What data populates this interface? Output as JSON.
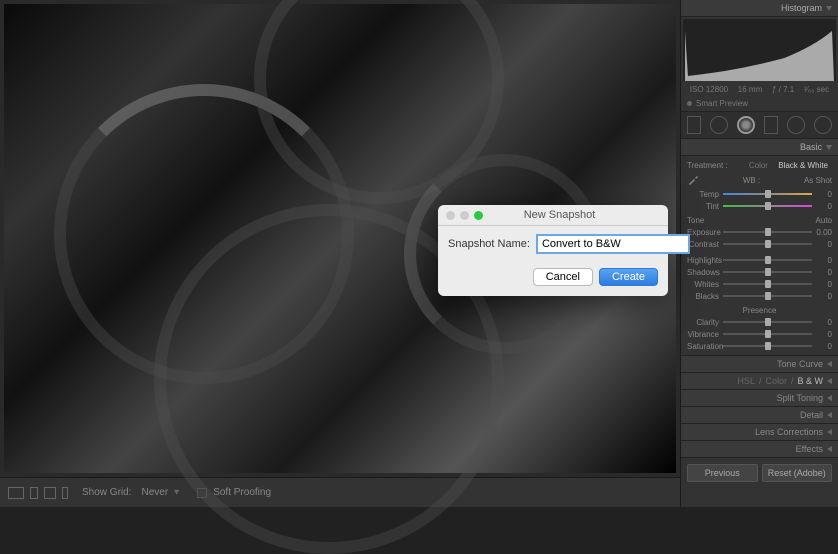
{
  "sidebar": {
    "histogram_label": "Histogram",
    "metadata": {
      "iso": "ISO 12800",
      "focal": "16 mm",
      "aperture": "ƒ / 7.1",
      "shutter": "¹⁄₆₀ sec"
    },
    "smart_preview": "Smart Preview",
    "basic": {
      "label": "Basic",
      "treatment": "Treatment :",
      "color": "Color",
      "bw": "Black & White",
      "wb_label": "WB :",
      "wb_value": "As Shot",
      "temp_label": "Temp",
      "temp_val": "0",
      "tint_label": "Tint",
      "tint_val": "0",
      "tone_label": "Tone",
      "auto_label": "Auto",
      "exposure_label": "Exposure",
      "exposure_val": "0.00",
      "contrast_label": "Contrast",
      "contrast_val": "0",
      "highlights_label": "Highlights",
      "highlights_val": "0",
      "shadows_label": "Shadows",
      "shadows_val": "0",
      "whites_label": "Whites",
      "whites_val": "0",
      "blacks_label": "Blacks",
      "blacks_val": "0",
      "presence_label": "Presence",
      "clarity_label": "Clarity",
      "clarity_val": "0",
      "vibrance_label": "Vibrance",
      "vibrance_val": "0",
      "saturation_label": "Saturation",
      "saturation_val": "0"
    },
    "panels": {
      "tone_curve": "Tone Curve",
      "hsl": "HSL",
      "color_p": "Color",
      "bw_p": "B & W",
      "split_toning": "Split Toning",
      "detail": "Detail",
      "lens": "Lens Corrections",
      "effects": "Effects"
    },
    "buttons": {
      "previous": "Previous",
      "reset": "Reset (Adobe)"
    }
  },
  "bottombar": {
    "show_grid": "Show Grid:",
    "never": "Never",
    "soft_proofing": "Soft Proofing"
  },
  "modal": {
    "title": "New Snapshot",
    "label": "Snapshot Name:",
    "value": "Convert to B&W",
    "cancel": "Cancel",
    "create": "Create"
  }
}
